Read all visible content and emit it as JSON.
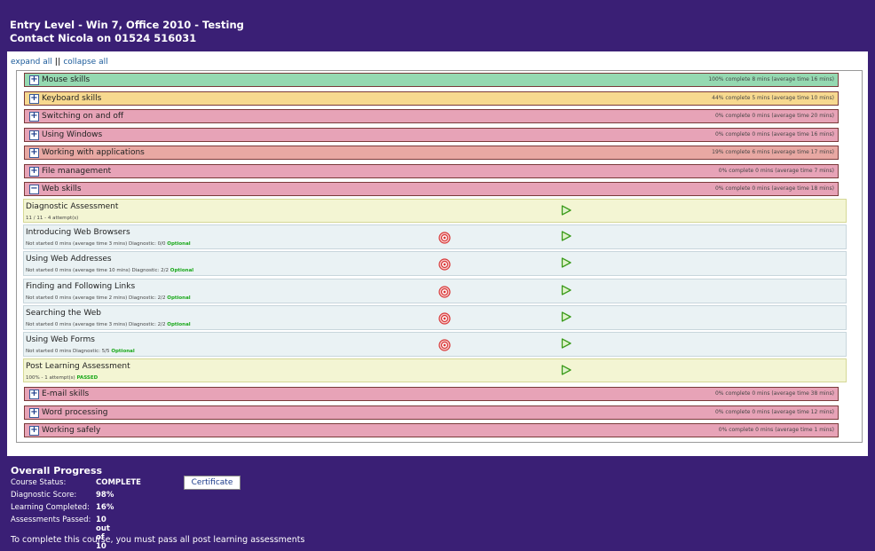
{
  "header": {
    "title": "Entry Level - Win 7, Office 2010 - Testing",
    "contact": "Contact Nicola on 01524 516031"
  },
  "controls": {
    "expand_all": "expand all",
    "separator": "||",
    "collapse_all": "collapse all"
  },
  "categories": [
    {
      "name": "Mouse skills",
      "stat": "100% complete  8 mins  (average time 16 mins)",
      "color": "#95d9b1",
      "symbol": "+"
    },
    {
      "name": "Keyboard skills",
      "stat": "44% complete  5 mins  (average time 10 mins)",
      "color": "#f7d98f",
      "symbol": "+"
    },
    {
      "name": "Switching on and off",
      "stat": "0% complete  0 mins  (average time 20 mins)",
      "color": "#e7a3b7",
      "symbol": "+"
    },
    {
      "name": "Using Windows",
      "stat": "0% complete  0 mins  (average time 16 mins)",
      "color": "#e7a3b7",
      "symbol": "+"
    },
    {
      "name": "Working with applications",
      "stat": "19% complete  6 mins  (average time 17 mins)",
      "color": "#e8a8a3",
      "symbol": "+"
    },
    {
      "name": "File management",
      "stat": "0% complete  0 mins  (average time 7 mins)",
      "color": "#e7a3b7",
      "symbol": "+"
    },
    {
      "name": "Web skills",
      "stat": "0% complete  0 mins  (average time 18 mins)",
      "color": "#e7a3b7",
      "symbol": "−"
    }
  ],
  "lessons": [
    {
      "title": "Diagnostic Assessment",
      "meta": "11 / 11 - 4 attempt(s)",
      "optional": "",
      "passed": "",
      "type": "assess",
      "target": false
    },
    {
      "title": "Introducing Web Browsers",
      "meta": "Not started   0 mins   (average time 3 mins)   Diagnostic: 0/0  ",
      "optional": "Optional",
      "passed": "",
      "type": "lesson",
      "target": true
    },
    {
      "title": "Using Web Addresses",
      "meta": "Not started   0 mins   (average time 10 mins)   Diagnostic: 2/2  ",
      "optional": "Optional",
      "passed": "",
      "type": "lesson",
      "target": true
    },
    {
      "title": "Finding and Following Links",
      "meta": "Not started   0 mins   (average time 2 mins)   Diagnostic: 2/2  ",
      "optional": "Optional",
      "passed": "",
      "type": "lesson",
      "target": true
    },
    {
      "title": "Searching the Web",
      "meta": "Not started   0 mins   (average time 3 mins)   Diagnostic: 2/2  ",
      "optional": "Optional",
      "passed": "",
      "type": "lesson",
      "target": true
    },
    {
      "title": "Using Web Forms",
      "meta": "Not started   0 mins    Diagnostic: 5/5  ",
      "optional": "Optional",
      "passed": "",
      "type": "lesson",
      "target": true
    },
    {
      "title": "Post Learning Assessment",
      "meta": "100% - 1 attempt(s) ",
      "optional": "",
      "passed": "PASSED",
      "type": "assess",
      "target": false
    }
  ],
  "categories_after": [
    {
      "name": "E-mail skills",
      "stat": "0% complete  0 mins  (average time 38 mins)",
      "color": "#e7a3b7",
      "symbol": "+"
    },
    {
      "name": "Word processing",
      "stat": "0% complete  0 mins  (average time 12 mins)",
      "color": "#e7a3b7",
      "symbol": "+"
    },
    {
      "name": "Working safely",
      "stat": "0% complete  0 mins  (average time 1 mins)",
      "color": "#e7a3b7",
      "symbol": "+"
    }
  ],
  "progress": {
    "heading": "Overall Progress",
    "course_status_label": "Course Status:",
    "course_status_value": "COMPLETE",
    "diagnostic_label": "Diagnostic Score:",
    "diagnostic_value": "98%",
    "learning_label": "Learning Completed:",
    "learning_value": "16%",
    "assessments_label": "Assessments Passed:",
    "assessments_value": "10 out of 10",
    "certificate_button": "Certificate"
  },
  "footer": "To complete this course, you must pass all post learning assessments"
}
